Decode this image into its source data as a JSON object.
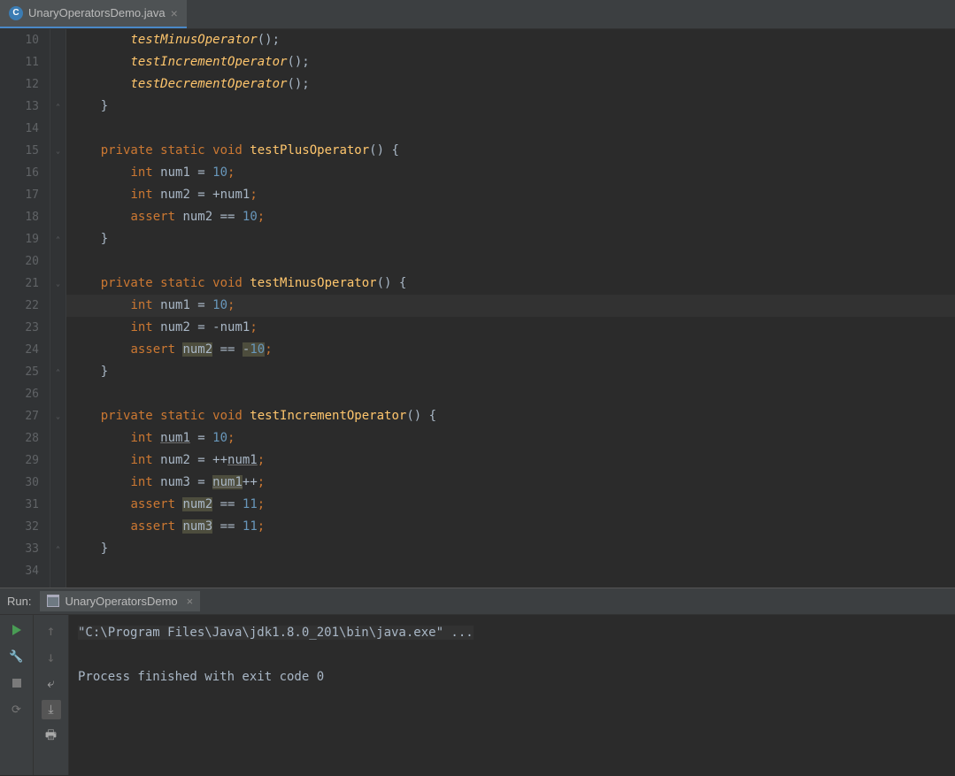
{
  "tab": {
    "name": "UnaryOperatorsDemo.java",
    "close": "×"
  },
  "lines": [
    10,
    11,
    12,
    13,
    14,
    15,
    16,
    17,
    18,
    19,
    20,
    21,
    22,
    23,
    24,
    25,
    26,
    27,
    28,
    29,
    30,
    31,
    32,
    33,
    34
  ],
  "currentLine": 22,
  "code": {
    "l10": {
      "indent": "        ",
      "call": "testMinusOperator",
      "after": "();"
    },
    "l11": {
      "indent": "        ",
      "call": "testIncrementOperator",
      "after": "();"
    },
    "l12": {
      "indent": "        ",
      "call": "testDecrementOperator",
      "after": "();"
    },
    "l13": {
      "brace": "    }"
    },
    "l14": {
      "blank": ""
    },
    "l15": {
      "indent": "    ",
      "mods": "private static void ",
      "name": "testPlusOperator",
      "after": "() {"
    },
    "l16": {
      "indent": "        ",
      "kw": "int ",
      "var": "num1 = ",
      "num": "10",
      "sc": ";"
    },
    "l17": {
      "indent": "        ",
      "kw": "int ",
      "var": "num2 = +num1",
      "sc": ";"
    },
    "l18": {
      "indent": "        ",
      "kw": "assert ",
      "var": "num2 == ",
      "num": "10",
      "sc": ";"
    },
    "l19": {
      "brace": "    }"
    },
    "l20": {
      "blank": ""
    },
    "l21": {
      "indent": "    ",
      "mods": "private static void ",
      "name": "testMinusOperator",
      "after": "() {"
    },
    "l22": {
      "indent": "        ",
      "kw": "int ",
      "var": "num1 = ",
      "num": "10",
      "sc": ";"
    },
    "l23": {
      "indent": "        ",
      "kw": "int ",
      "var": "num2 = -num1",
      "sc": ";"
    },
    "l24": {
      "indent": "        ",
      "kw": "assert ",
      "hl1": "num2",
      "mid": " == ",
      "hl2": "-",
      "hlnum": "10",
      "sc": ";"
    },
    "l25": {
      "brace": "    }"
    },
    "l26": {
      "blank": ""
    },
    "l27": {
      "indent": "    ",
      "mods": "private static void ",
      "name": "testIncrementOperator",
      "after": "() {"
    },
    "l28": {
      "indent": "        ",
      "kw": "int ",
      "ul": "num1",
      "mid": " = ",
      "num": "10",
      "sc": ";"
    },
    "l29": {
      "indent": "        ",
      "kw": "int ",
      "var": "num2 = ++",
      "ul": "num1",
      "sc": ";"
    },
    "l30": {
      "indent": "        ",
      "kw": "int ",
      "var": "num3 = ",
      "hlul": "num1",
      "after": "++",
      "sc": ";"
    },
    "l31": {
      "indent": "        ",
      "kw": "assert ",
      "hl1": "num2",
      "mid": " == ",
      "num": "11",
      "sc": ";"
    },
    "l32": {
      "indent": "        ",
      "kw": "assert ",
      "hl1": "num3",
      "mid": " == ",
      "num": "11",
      "sc": ";"
    },
    "l33": {
      "brace": "    }"
    },
    "l34": {
      "blank": ""
    }
  },
  "run": {
    "label": "Run:",
    "tabName": "UnaryOperatorsDemo",
    "close": "×",
    "cmd": "\"C:\\Program Files\\Java\\jdk1.8.0_201\\bin\\java.exe\" ...",
    "exit": "Process finished with exit code 0"
  }
}
